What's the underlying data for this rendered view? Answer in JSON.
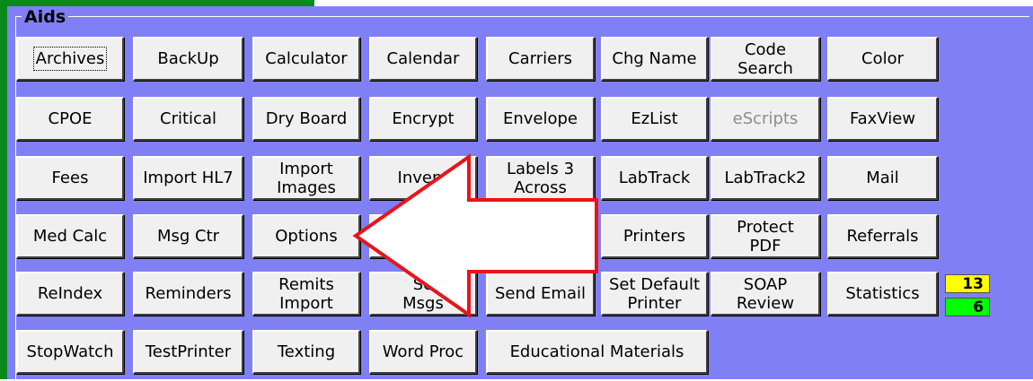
{
  "group_title": "Aids",
  "buttons": {
    "archives": "Archives",
    "backup": "BackUp",
    "calculator": "Calculator",
    "calendar": "Calendar",
    "carriers": "Carriers",
    "chg_name": "Chg Name",
    "code_search": "Code\nSearch",
    "color": "Color",
    "cpoe": "CPOE",
    "critical": "Critical",
    "dry_board": "Dry Board",
    "encrypt": "Encrypt",
    "envelope": "Envelope",
    "ezlist": "EzList",
    "escripts": "eScripts",
    "faxview": "FaxView",
    "fees": "Fees",
    "import_hl7": "Import HL7",
    "import_images": "Import\nImages",
    "inventory": "Invent",
    "labels": "Labels 3\nAcross",
    "labtrack": "LabTrack",
    "labtrack2": "LabTrack2",
    "mail": "Mail",
    "med_calc": "Med Calc",
    "msg_ctr": "Msg Ctr",
    "options": "Options",
    "printers": "Printers",
    "protect_pdf": "Protect\nPDF",
    "referrals": "Referrals",
    "reindex": "ReIndex",
    "reminders": "Reminders",
    "remits_import": "Remits\nImport",
    "secure_msgs": "Se\nMsgs",
    "send_email": "Send Email",
    "set_default_printer": "Set Default\nPrinter",
    "soap_review": "SOAP\nReview",
    "statistics": "Statistics",
    "stopwatch": "StopWatch",
    "testprinter": "TestPrinter",
    "texting": "Texting",
    "word_proc": "Word Proc",
    "educational_materials": "Educational Materials"
  },
  "badges": {
    "yellow_count": "13",
    "green_count": "6"
  },
  "colors": {
    "panel_background": "#8080f4",
    "button_face": "#f0f0f0",
    "arrow_outline": "#e8141c",
    "yellow_badge": "#ffff00",
    "green_badge": "#00ff00"
  }
}
